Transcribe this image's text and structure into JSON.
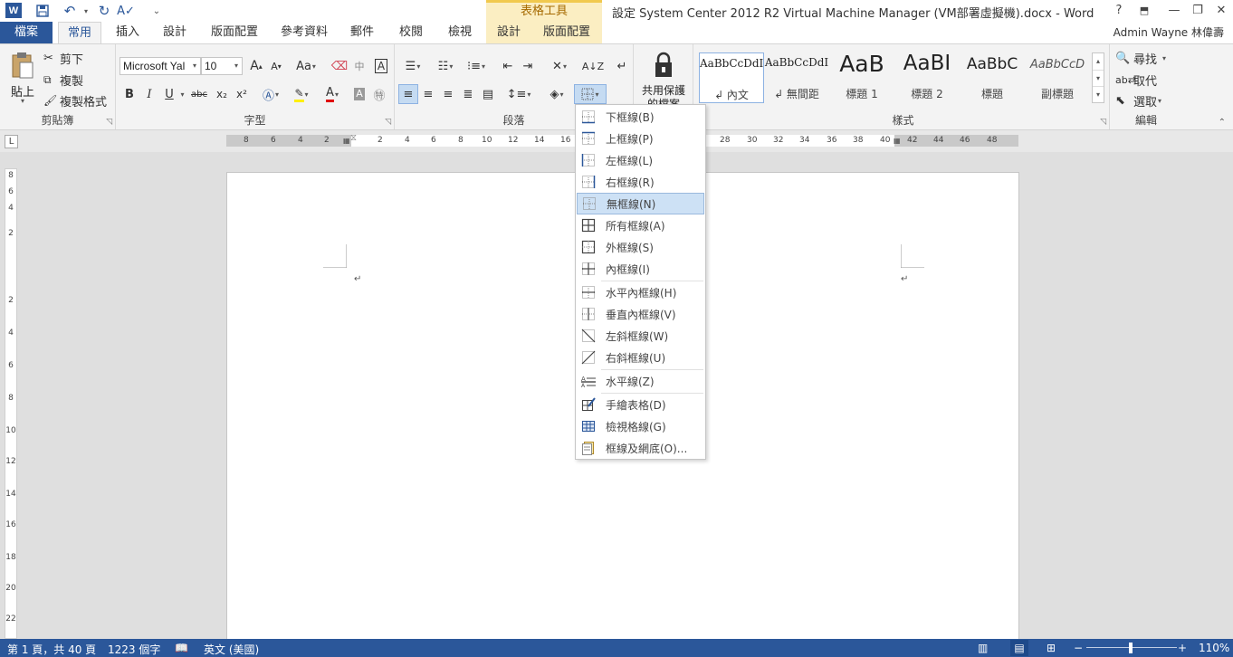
{
  "titlebar": {
    "logo": "W",
    "qat_customize": "⌄",
    "context_group": "表格工具",
    "document_title": "設定 System Center 2012 R2 Virtual Machine Manager (VM部署虛擬機).docx - Word",
    "help": "?",
    "minimize": "—",
    "restore": "❐",
    "close": "✕"
  },
  "tabs": {
    "file": "檔案",
    "items": [
      "常用",
      "插入",
      "設計",
      "版面配置",
      "參考資料",
      "郵件",
      "校閱",
      "檢視"
    ],
    "ctx_items": [
      "設計",
      "版面配置"
    ],
    "user": "Admin Wayne 林偉壽"
  },
  "clipboard": {
    "paste": "貼上",
    "cut": "剪下",
    "copy": "複製",
    "format_painter": "複製格式",
    "label": "剪貼簿"
  },
  "font": {
    "name": "Microsoft Yal",
    "size": "10",
    "grow": "A",
    "shrink": "A",
    "case": "Aa",
    "bold": "B",
    "italic": "I",
    "underline": "U",
    "strike": "abc",
    "sub": "x₂",
    "sup": "x²",
    "color_a": "A",
    "label": "字型"
  },
  "paragraph": {
    "label": "段落"
  },
  "protect": {
    "line1": "共用保護",
    "line2": "的檔案"
  },
  "styles": {
    "items": [
      {
        "sample": "AaBbCcDdI",
        "name": "↲ 內文"
      },
      {
        "sample": "AaBbCcDdI",
        "name": "↲ 無間距"
      },
      {
        "sample": "AaB",
        "name": "標題 1"
      },
      {
        "sample": "AaBI",
        "name": "標題 2"
      },
      {
        "sample": "AaBbC",
        "name": "標題"
      },
      {
        "sample": "AaBbCcD",
        "name": "副標題"
      }
    ],
    "label": "樣式"
  },
  "editing": {
    "find": "尋找",
    "replace": "取代",
    "select": "選取",
    "label": "編輯"
  },
  "ruler": {
    "corner": "L",
    "ticks": [
      "8",
      "6",
      "4",
      "2",
      "2",
      "4",
      "6",
      "8",
      "10",
      "12",
      "14",
      "16",
      "28",
      "30",
      "32",
      "34",
      "36",
      "38",
      "40",
      "42",
      "44",
      "46",
      "48"
    ],
    "vticks": [
      "8",
      "6",
      "4",
      "2",
      "2",
      "4",
      "6",
      "8",
      "10",
      "12",
      "14",
      "16",
      "18",
      "20",
      "22"
    ]
  },
  "border_menu": {
    "items": [
      {
        "label": "下框線(B)",
        "icon": "bottom-border-icon"
      },
      {
        "label": "上框線(P)",
        "icon": "top-border-icon"
      },
      {
        "label": "左框線(L)",
        "icon": "left-border-icon"
      },
      {
        "label": "右框線(R)",
        "icon": "right-border-icon"
      },
      {
        "label": "無框線(N)",
        "icon": "no-border-icon"
      },
      {
        "label": "所有框線(A)",
        "icon": "all-borders-icon"
      },
      {
        "label": "外框線(S)",
        "icon": "outside-borders-icon"
      },
      {
        "label": "內框線(I)",
        "icon": "inside-borders-icon"
      },
      {
        "label": "水平內框線(H)",
        "icon": "inside-horizontal-border-icon"
      },
      {
        "label": "垂直內框線(V)",
        "icon": "inside-vertical-border-icon"
      },
      {
        "label": "左斜框線(W)",
        "icon": "diagonal-down-border-icon"
      },
      {
        "label": "右斜框線(U)",
        "icon": "diagonal-up-border-icon"
      },
      {
        "label": "水平線(Z)",
        "icon": "horizontal-line-icon"
      },
      {
        "label": "手繪表格(D)",
        "icon": "draw-table-icon"
      },
      {
        "label": "檢視格線(G)",
        "icon": "view-gridlines-icon"
      },
      {
        "label": "框線及網底(O)...",
        "icon": "borders-shading-icon"
      }
    ],
    "highlighted": "無框線(N)"
  },
  "status": {
    "page": "第 1 頁，共 40 頁",
    "words": "1223 個字",
    "language": "英文 (美國)",
    "zoom": "110%",
    "zoom_minus": "−",
    "zoom_plus": "+"
  },
  "colors": {
    "word_blue": "#2b579a",
    "ctx_tab": "#fbeec2",
    "highlight": "#cde1f5"
  }
}
